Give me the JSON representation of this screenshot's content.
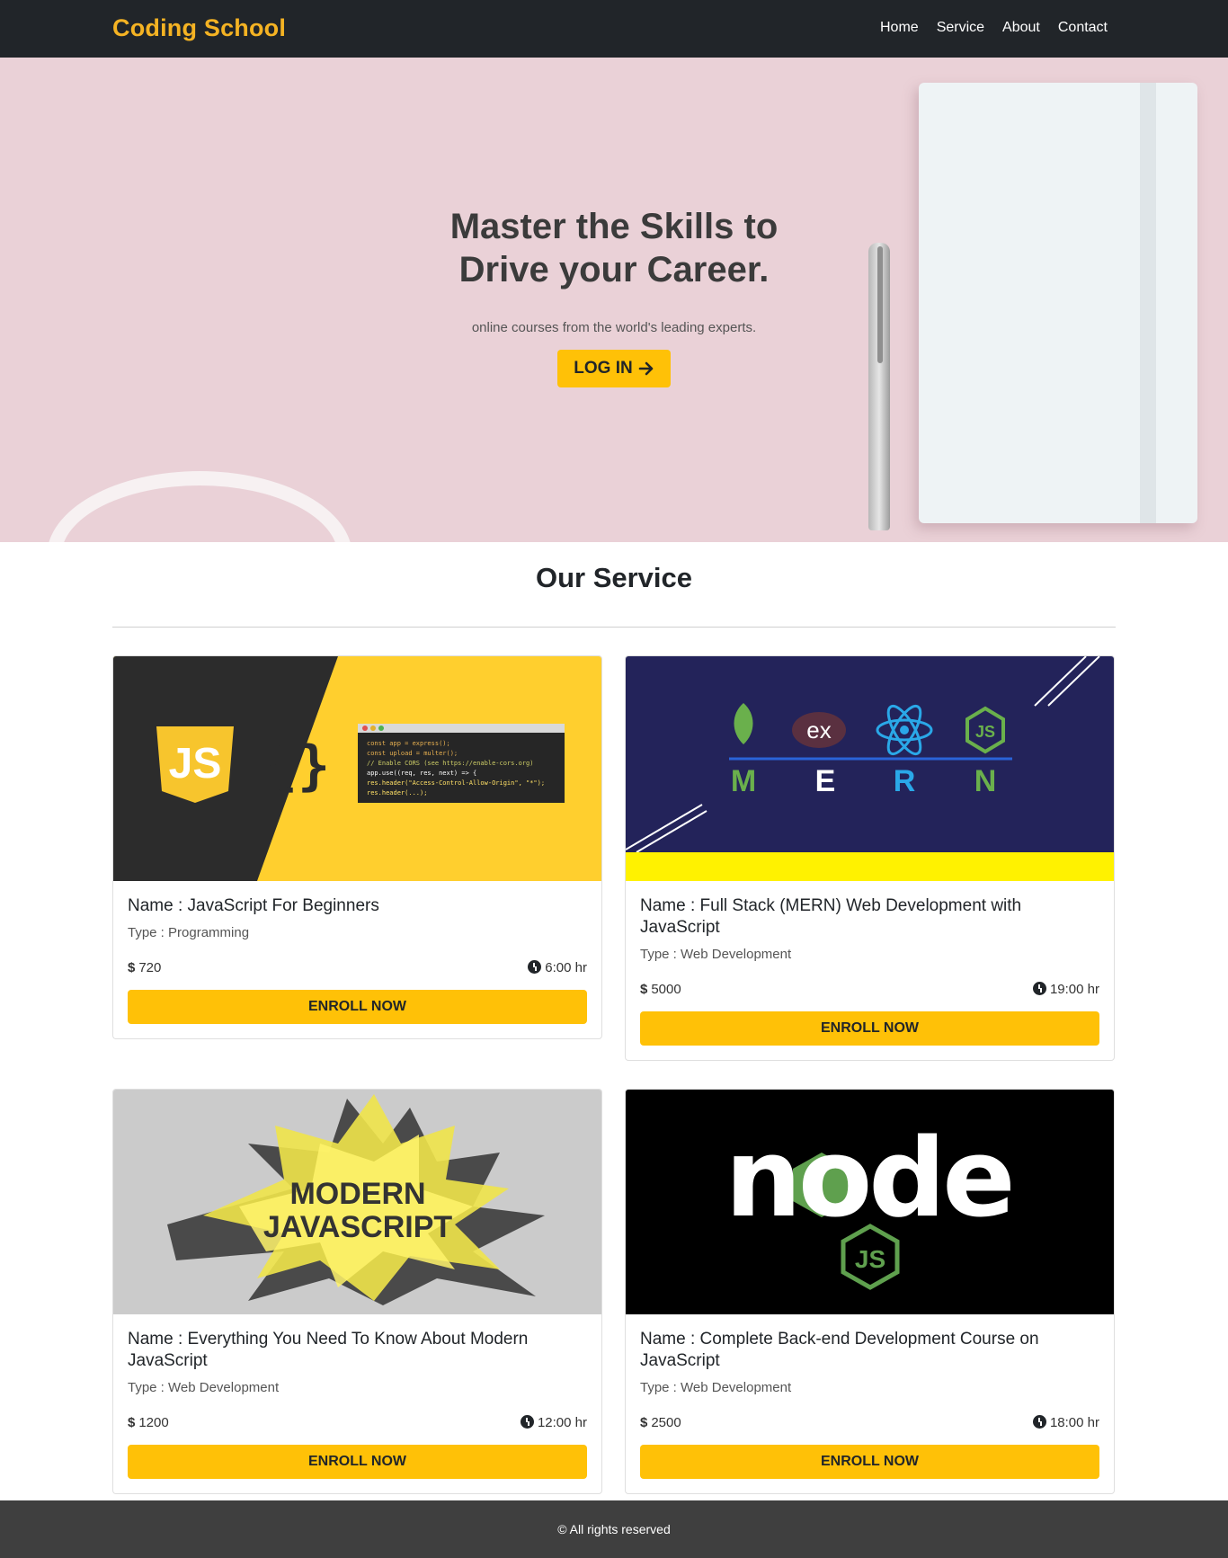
{
  "brand": "Coding School",
  "nav": [
    "Home",
    "Service",
    "About",
    "Contact"
  ],
  "hero": {
    "title": "Master the Skills to Drive your Career.",
    "subtitle": "online courses from the world's leading experts.",
    "login_label": "LOG IN",
    "login_icon": "arrow-right-icon"
  },
  "section_title": "Our Service",
  "cards": [
    {
      "name": "Name : JavaScript For Beginners",
      "type": "Type : Programming",
      "price": "720",
      "duration": "6:00 hr",
      "enroll": "ENROLL NOW",
      "image": "javascript-banner"
    },
    {
      "name": "Name : Full Stack (MERN) Web Development with JavaScript",
      "type": "Type : Web Development",
      "price": "5000",
      "duration": "19:00 hr",
      "enroll": "ENROLL NOW",
      "image": "mern-banner"
    },
    {
      "name": "Name : Everything You Need To Know About Modern JavaScript",
      "type": "Type : Web Development",
      "price": "1200",
      "duration": "12:00 hr",
      "enroll": "ENROLL NOW",
      "image": "modern-javascript-banner"
    },
    {
      "name": "Name : Complete Back-end Development Course on JavaScript",
      "type": "Type : Web Development",
      "price": "2500",
      "duration": "18:00 hr",
      "enroll": "ENROLL NOW",
      "image": "nodejs-banner"
    }
  ],
  "images": {
    "js_logo": "JS",
    "code_lines": [
      "const app = express();",
      "const upload = multer();",
      "// Enable CORS (see https://enable-cors.org)",
      "app.use((req, res, next) => {",
      "  res.header(\"Access-Control-Allow-Origin\", \"*\");",
      "  res.header(...);"
    ],
    "mern_letters": [
      "M",
      "E",
      "R",
      "N"
    ],
    "mern_ex": "ex",
    "mern_js": "JS",
    "modern_js": [
      "MODERN",
      "JAVASCRIPT"
    ],
    "node_text": "node",
    "node_js": "JS"
  },
  "footer": "© All rights reserved",
  "colors": {
    "navbar": "#212529",
    "brand": "#f5b323",
    "accent": "#ffc107",
    "hero_bg": "#ead1d7",
    "footer": "#3f3f3f"
  }
}
